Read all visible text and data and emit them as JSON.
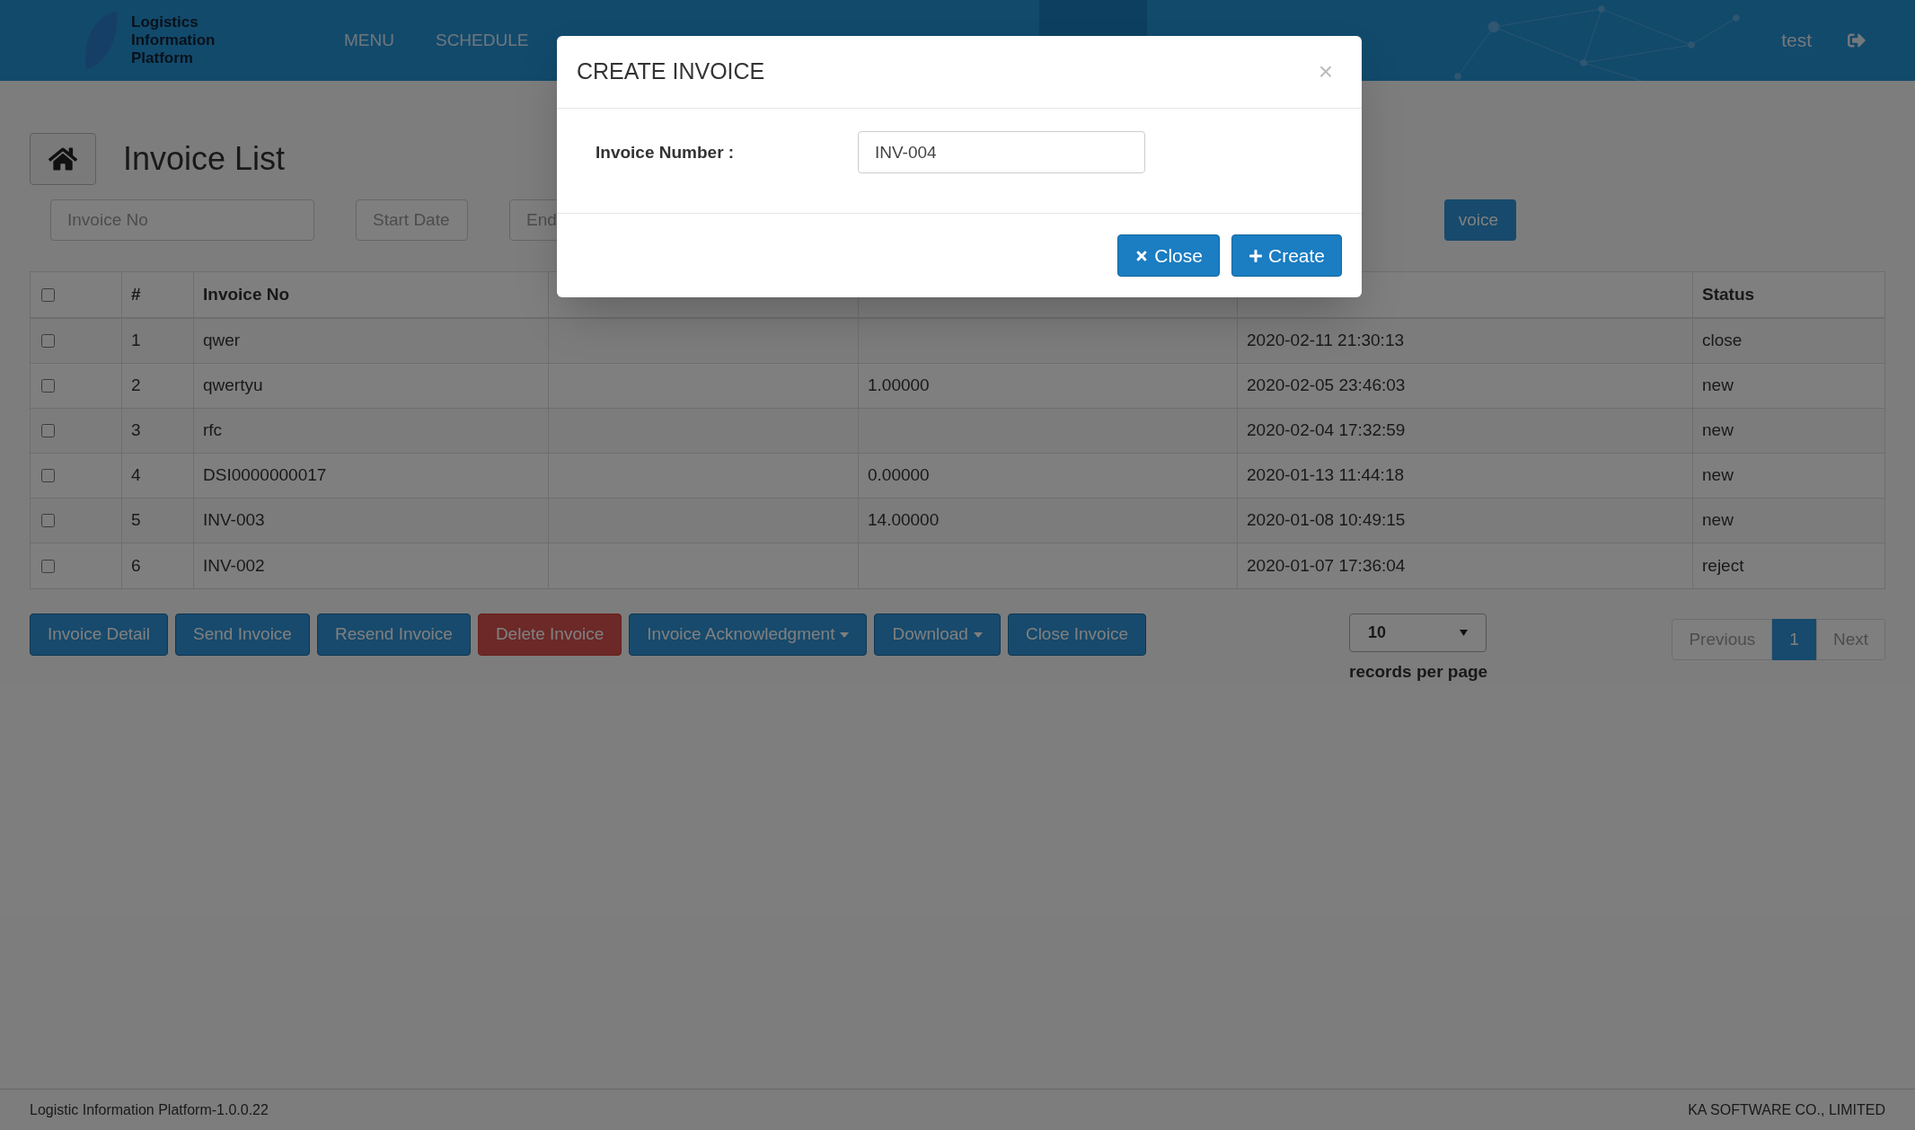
{
  "header": {
    "logo": [
      "Logistics",
      "Information",
      "Platform"
    ],
    "nav": [
      {
        "label": "MENU",
        "selected": false
      },
      {
        "label": "SCHEDULE",
        "selected": false
      }
    ],
    "user": "test"
  },
  "page": {
    "title": "Invoice List"
  },
  "filters": {
    "invoice_no": {
      "placeholder": "Invoice No"
    },
    "start_date": {
      "placeholder": "Start Date"
    },
    "end_date": {
      "placeholder": "End"
    },
    "button": "voice"
  },
  "table": {
    "columns": [
      "#",
      "Invoice No",
      "Status"
    ],
    "all_checked": false,
    "rows": [
      {
        "checked": false,
        "cells": [
          "1",
          "qwer",
          "",
          "",
          "2020-02-11 21:30:13",
          "close"
        ]
      },
      {
        "checked": false,
        "cells": [
          "2",
          "qwertyu",
          "",
          "1.00000",
          "2020-02-05 23:46:03",
          "new"
        ]
      },
      {
        "checked": false,
        "cells": [
          "3",
          "rfc",
          "",
          "",
          "2020-02-04 17:32:59",
          "new"
        ]
      },
      {
        "checked": false,
        "cells": [
          "4",
          "DSI0000000017",
          "",
          "0.00000",
          "2020-01-13 11:44:18",
          "new"
        ]
      },
      {
        "checked": false,
        "cells": [
          "5",
          "INV-003",
          "",
          "14.00000",
          "2020-01-08 10:49:15",
          "new"
        ]
      },
      {
        "checked": false,
        "cells": [
          "6",
          "INV-002",
          "",
          "",
          "2020-01-07 17:36:04",
          "reject"
        ]
      }
    ]
  },
  "actions": [
    {
      "label": "Invoice Detail",
      "kind": "primary",
      "dropdown": false
    },
    {
      "label": "Send Invoice",
      "kind": "primary",
      "dropdown": false
    },
    {
      "label": "Resend Invoice",
      "kind": "primary",
      "dropdown": false
    },
    {
      "label": "Delete Invoice",
      "kind": "danger",
      "dropdown": false
    },
    {
      "label": "Invoice Acknowledgment",
      "kind": "primary",
      "dropdown": true
    },
    {
      "label": "Download",
      "kind": "primary",
      "dropdown": true
    },
    {
      "label": "Close Invoice",
      "kind": "primary",
      "dropdown": false
    }
  ],
  "page_size": {
    "value": "10",
    "label": "records per page"
  },
  "pagination": [
    {
      "label": "Previous",
      "selected": false
    },
    {
      "label": "1",
      "selected": true
    },
    {
      "label": "Next",
      "selected": false
    }
  ],
  "footer": {
    "left": "Logistic Information Platform-1.0.0.22",
    "right": "KA SOFTWARE CO., LIMITED"
  },
  "modal": {
    "title": "CREATE INVOICE",
    "close_symbol": "×",
    "field_label": "Invoice Number :",
    "field_value": "INV-004",
    "buttons": [
      {
        "label": "Close",
        "kind": "close"
      },
      {
        "label": "Create",
        "kind": "create"
      }
    ]
  }
}
